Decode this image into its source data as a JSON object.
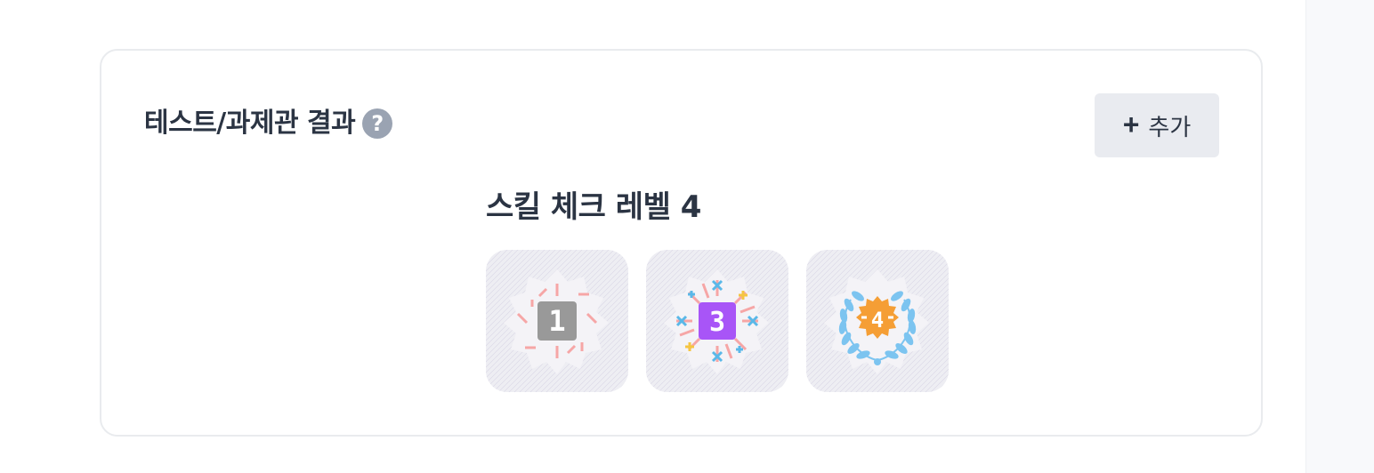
{
  "card": {
    "title": "테스트/과제관 결과",
    "help_glyph": "?",
    "add_button": {
      "icon": "+",
      "label": "추가"
    }
  },
  "skill_check": {
    "title": "스킬 체크 레벨 4",
    "badges": [
      {
        "number": "1",
        "icon": "level-1-badge-icon",
        "color": "#999999"
      },
      {
        "number": "3",
        "icon": "level-3-badge-icon",
        "color": "#a855f7"
      },
      {
        "number": "4",
        "icon": "level-4-badge-icon",
        "color": "#f59e35"
      }
    ]
  },
  "colors": {
    "text": "#2b3443",
    "help_icon": "#9aa3b2",
    "button_bg": "#e9ebf0",
    "ray_pink": "#f6a6a6",
    "sparkle_blue": "#5ab8e8",
    "sparkle_yellow": "#f5c542",
    "laurel_blue": "#7cc4f0"
  }
}
